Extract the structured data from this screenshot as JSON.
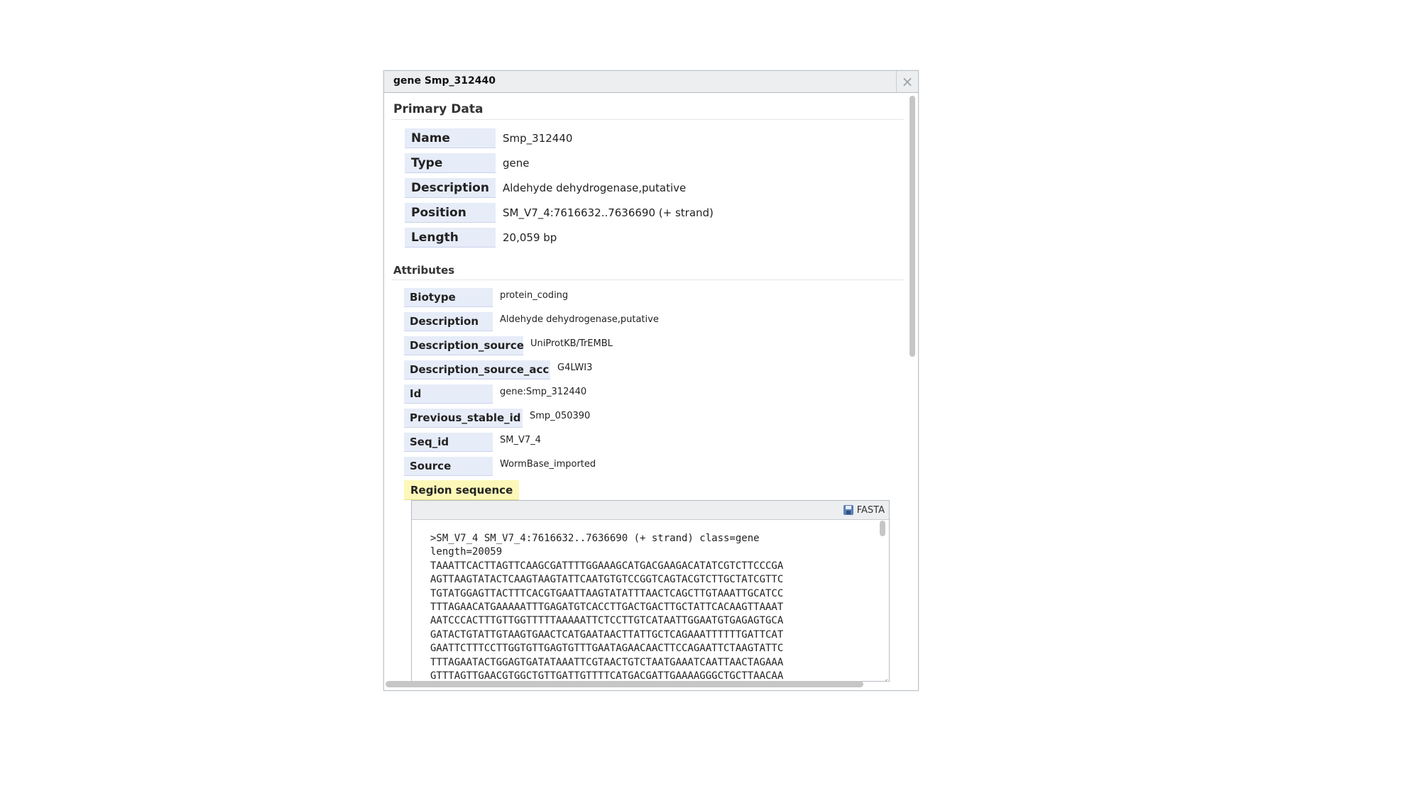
{
  "dialog": {
    "title": "gene Smp_312440",
    "close_glyph": "×"
  },
  "primary_data": {
    "heading": "Primary Data",
    "rows": [
      {
        "label": "Name",
        "value": "Smp_312440"
      },
      {
        "label": "Type",
        "value": "gene"
      },
      {
        "label": "Description",
        "value": "Aldehyde dehydrogenase,putative"
      },
      {
        "label": "Position",
        "value": "SM_V7_4:7616632..7636690 (+ strand)"
      },
      {
        "label": "Length",
        "value": "20,059 bp"
      }
    ]
  },
  "attributes": {
    "heading": "Attributes",
    "rows": [
      {
        "label": "Biotype",
        "value": "protein_coding"
      },
      {
        "label": "Description",
        "value": "Aldehyde dehydrogenase,putative"
      },
      {
        "label": "Description_source",
        "value": "UniProtKB/TrEMBL"
      },
      {
        "label": "Description_source_acc",
        "value": "G4LWI3"
      },
      {
        "label": "Id",
        "value": "gene:Smp_312440"
      },
      {
        "label": "Previous_stable_id",
        "value": "Smp_050390"
      },
      {
        "label": "Seq_id",
        "value": "SM_V7_4"
      },
      {
        "label": "Source",
        "value": "WormBase_imported"
      }
    ]
  },
  "region_sequence": {
    "label": "Region sequence",
    "fasta_button": "FASTA",
    "lines": [
      ">SM_V7_4 SM_V7_4:7616632..7636690 (+ strand) class=gene",
      "length=20059",
      "TAAATTCACTTAGTTCAAGCGATTTTGGAAAGCATGACGAAGACATATCGTCTTCCCGA",
      "AGTTAAGTATACTCAAGTAAGTATTCAATGTGTCCGGTCAGTACGTCTTGCTATCGTTC",
      "TGTATGGAGTTACTTTCACGTGAATTAAGTATATTTAACTCAGCTTGTAAATTGCATCC",
      "TTTAGAACATGAAAAATTTGAGATGTCACCTTGACTGACTTGCTATTCACAAGTTAAAT",
      "AATCCCACTTTGTTGGTTTTTAAAAATTCTCCTTGTCATAATTGGAATGTGAGAGTGCA",
      "GATACTGTATTGTAAGTGAACTCATGAATAACTTATTGCTCAGAAATTTTTTGATTCAT",
      "GAATTCTTTCCTTGGTGTTGAGTGTTTGAATAGAACAACTTCCAGAATTCTAAGTATTC",
      "TTTAGAATACTGGAGTGATATAAATTCGTAACTGTCTAATGAAATCAATTAACTAGAAA",
      "GTTTAGTTGAACGTGGCTGTTGATTGTTTTCATGACGATTGAAAAGGGCTGCTTAACAA"
    ]
  }
}
